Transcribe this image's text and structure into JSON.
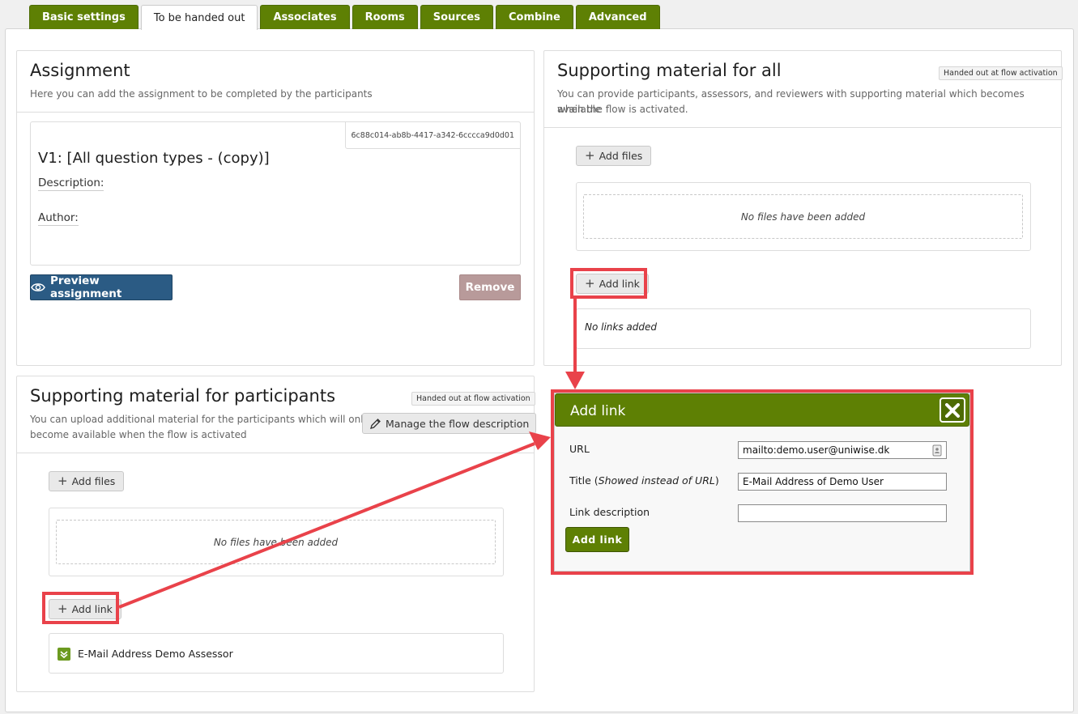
{
  "tabs": [
    {
      "label": "Basic settings",
      "active": false
    },
    {
      "label": "To be handed out",
      "active": true
    },
    {
      "label": "Associates",
      "active": false
    },
    {
      "label": "Rooms",
      "active": false
    },
    {
      "label": "Sources",
      "active": false
    },
    {
      "label": "Combine",
      "active": false
    },
    {
      "label": "Advanced",
      "active": false
    }
  ],
  "assignment": {
    "title": "Assignment",
    "subtitle": "Here you can add the assignment to be completed by the participants",
    "id": "6c88c014-ab8b-4417-a342-6cccca9d0d01",
    "name": "V1: [All question types - (copy)]",
    "description_label": "Description:",
    "author_label": "Author:",
    "preview_label": "Preview assignment",
    "remove_label": "Remove"
  },
  "support_all": {
    "title": "Supporting material for all",
    "badge": "Handed out at flow activation",
    "subtitle_line1": "You can provide participants, assessors, and reviewers with supporting material which becomes available",
    "subtitle_line2": "when the flow is activated.",
    "add_files_label": "Add files",
    "no_files": "No files have been added",
    "add_link_label": "Add link",
    "no_links": "No links added"
  },
  "support_participants": {
    "title": "Supporting material for participants",
    "badge": "Handed out at flow activation",
    "subtitle_line1": "You can upload additional material for the participants which will only",
    "subtitle_line2": "become available when the flow is activated",
    "manage_label": "Manage the flow description",
    "add_files_label": "Add files",
    "no_files": "No files have been added",
    "add_link_label": "Add link",
    "link_item": "E-Mail Address Demo Assessor"
  },
  "add_link_dialog": {
    "title": "Add link",
    "url_label": "URL",
    "url_value": "mailto:demo.user@uniwise.dk",
    "title_label_main": "Title (",
    "title_label_italic": "Showed instead of URL",
    "title_label_end": ")",
    "title_value": "E-Mail Address of Demo User",
    "desc_label": "Link description",
    "desc_value": "",
    "submit_label": "Add link"
  },
  "colors": {
    "tab_green": "#5e8004",
    "preview_blue": "#2b5b84",
    "remove_rose": "#b89a9a",
    "highlight_red": "#e9424a",
    "dialog_header": "#5e8004"
  }
}
